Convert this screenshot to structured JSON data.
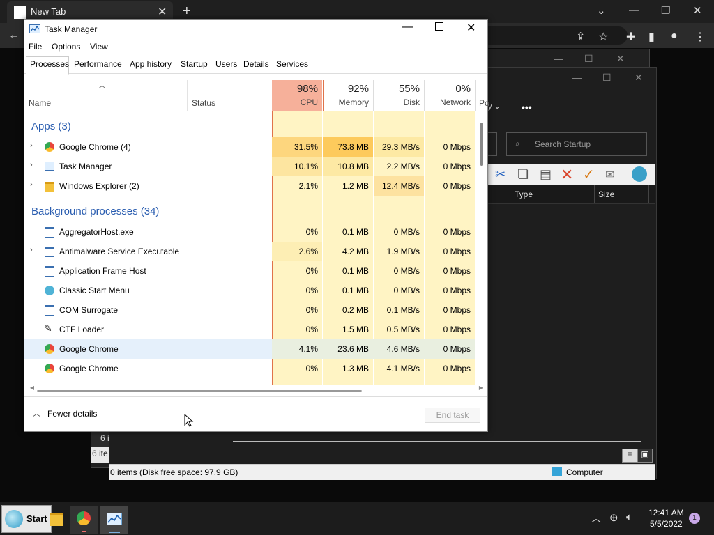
{
  "browser": {
    "tab_title": "New Tab",
    "tab_close": "✕",
    "new_tab": "+",
    "win_min": "⌄",
    "win_min2": "—",
    "win_restore": "❐",
    "win_close": "✕"
  },
  "explorer": {
    "search_placeholder": "Search Startup",
    "col_type": "Type",
    "col_size": "Size",
    "dots": "•••",
    "sort_caret": "y ⌄",
    "items_short": "6 i",
    "items_short2": "6 ite",
    "status_text": "0 items (Disk free space: 97.9 GB)",
    "location": "Computer"
  },
  "tm": {
    "title": "Task Manager",
    "menu": [
      "File",
      "Options",
      "View"
    ],
    "tabs": [
      "Processes",
      "Performance",
      "App history",
      "Startup",
      "Users",
      "Details",
      "Services"
    ],
    "headers": {
      "name": "Name",
      "status": "Status",
      "cpu_pct": "98%",
      "cpu": "CPU",
      "mem_pct": "92%",
      "mem": "Memory",
      "disk_pct": "55%",
      "disk": "Disk",
      "net_pct": "0%",
      "net": "Network",
      "power": "Po"
    },
    "groups": {
      "apps": "Apps (3)",
      "background": "Background processes (34)"
    },
    "rows": [
      {
        "name": "Google Chrome (4)",
        "cpu": "31.5%",
        "mem": "73.8 MB",
        "disk": "29.3 MB/s",
        "net": "0 Mbps"
      },
      {
        "name": "Task Manager",
        "cpu": "10.1%",
        "mem": "10.8 MB",
        "disk": "2.2 MB/s",
        "net": "0 Mbps"
      },
      {
        "name": "Windows Explorer (2)",
        "cpu": "2.1%",
        "mem": "1.2 MB",
        "disk": "12.4 MB/s",
        "net": "0 Mbps"
      },
      {
        "name": "AggregatorHost.exe",
        "cpu": "0%",
        "mem": "0.1 MB",
        "disk": "0 MB/s",
        "net": "0 Mbps"
      },
      {
        "name": "Antimalware Service Executable",
        "cpu": "2.6%",
        "mem": "4.2 MB",
        "disk": "1.9 MB/s",
        "net": "0 Mbps"
      },
      {
        "name": "Application Frame Host",
        "cpu": "0%",
        "mem": "0.1 MB",
        "disk": "0 MB/s",
        "net": "0 Mbps"
      },
      {
        "name": "Classic Start Menu",
        "cpu": "0%",
        "mem": "0.1 MB",
        "disk": "0 MB/s",
        "net": "0 Mbps"
      },
      {
        "name": "COM Surrogate",
        "cpu": "0%",
        "mem": "0.2 MB",
        "disk": "0.1 MB/s",
        "net": "0 Mbps"
      },
      {
        "name": "CTF Loader",
        "cpu": "0%",
        "mem": "1.5 MB",
        "disk": "0.5 MB/s",
        "net": "0 Mbps"
      },
      {
        "name": "Google Chrome",
        "cpu": "4.1%",
        "mem": "23.6 MB",
        "disk": "4.6 MB/s",
        "net": "0 Mbps"
      },
      {
        "name": "Google Chrome",
        "cpu": "0%",
        "mem": "1.3 MB",
        "disk": "4.1 MB/s",
        "net": "0 Mbps"
      }
    ],
    "fewer_details": "Fewer details",
    "end_task": "End task"
  },
  "taskbar": {
    "start": "Start",
    "time": "12:41 AM",
    "date": "5/5/2022",
    "notif_count": "1"
  }
}
